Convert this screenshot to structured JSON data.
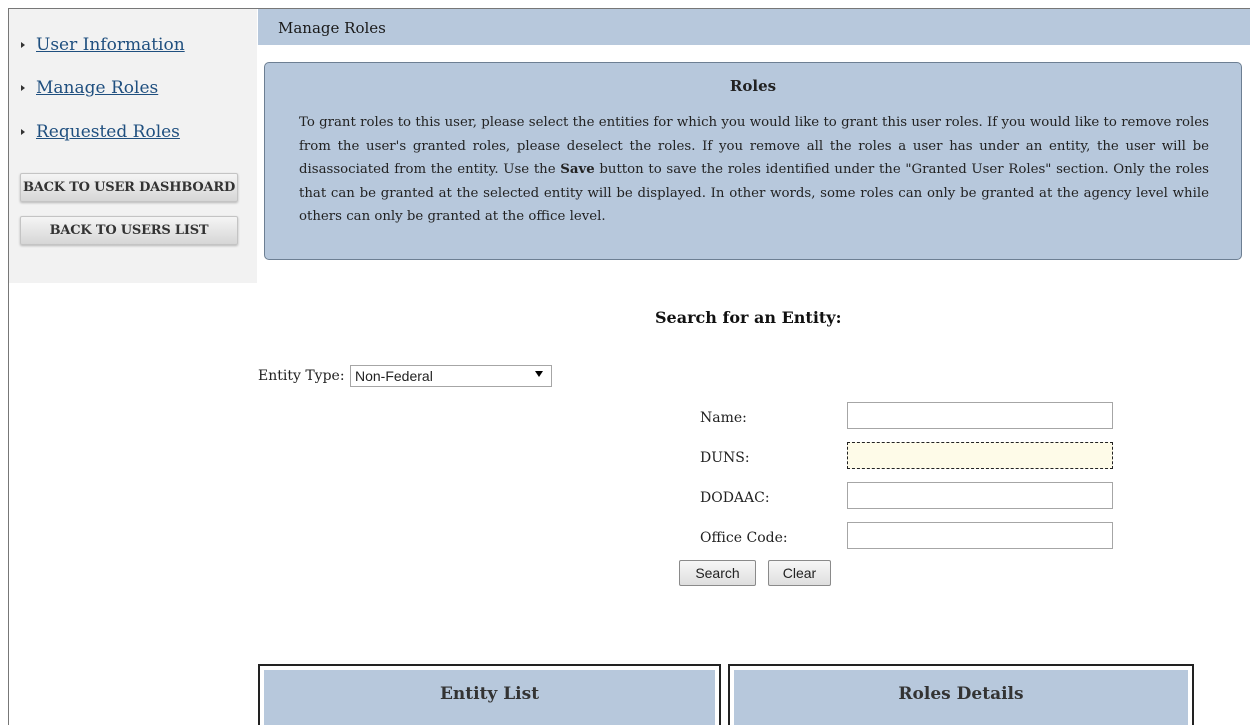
{
  "sidebar": {
    "nav_items": [
      {
        "label": "User Information"
      },
      {
        "label": "Manage Roles"
      },
      {
        "label": "Requested Roles"
      }
    ],
    "buttons": {
      "back_dashboard": "BACK TO USER DASHBOARD",
      "back_users_list": "BACK TO USERS LIST"
    }
  },
  "header": {
    "title": "Manage Roles"
  },
  "roles_box": {
    "heading": "Roles",
    "text_part1": "To grant roles to this user, please select the entities for which you would like to grant this user roles. If you would like to remove roles from the user's granted roles, please deselect the roles. If you remove all the roles a user has under an entity, the user will be disassociated from the entity. Use the ",
    "text_bold": "Save",
    "text_part2": " button to save the roles identified under the \"Granted User Roles\" section. Only the roles that can be granted at the selected entity will be displayed. In other words, some roles can only be granted at the agency level while others can only be granted at the office level."
  },
  "search": {
    "title": "Search for an Entity:",
    "entity_type_label": "Entity Type:",
    "entity_type_value": "Non-Federal",
    "fields": {
      "name_label": "Name:",
      "duns_label": "DUNS:",
      "dodaac_label": "DODAAC:",
      "office_code_label": "Office Code:",
      "name_value": "",
      "duns_value": "",
      "dodaac_value": "",
      "office_code_value": ""
    },
    "search_button": "Search",
    "clear_button": "Clear"
  },
  "panels": {
    "entity_list_title": "Entity List",
    "roles_details_title": "Roles Details"
  }
}
